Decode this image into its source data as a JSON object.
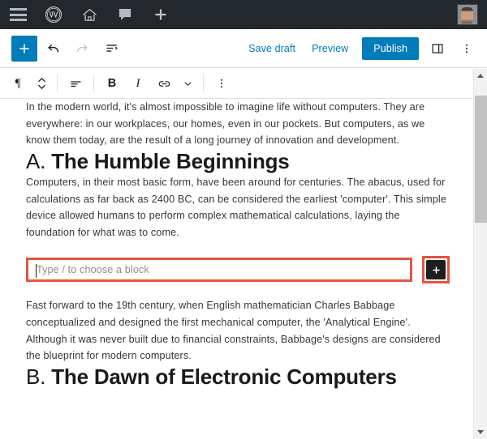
{
  "adminbar": {
    "menu_icon": "hamburger-menu-icon",
    "wordpress_icon": "wordpress-logo-icon",
    "home_icon": "home-icon",
    "comments_icon": "comment-bubble-icon",
    "new_icon": "plus-icon",
    "avatar": "user-avatar",
    "background_color": "#23282d"
  },
  "header": {
    "inserter_label": "+",
    "undo_icon": "undo-arrow-icon",
    "redo_icon": "redo-arrow-icon",
    "listview_icon": "list-view-icon",
    "save_draft_label": "Save draft",
    "preview_label": "Preview",
    "publish_label": "Publish",
    "settings_icon": "settings-sidebar-icon",
    "options_icon": "more-options-icon",
    "accent_color": "#007cba"
  },
  "block_toolbar": {
    "block_type_icon": "paragraph-icon",
    "block_type_glyph": "¶",
    "move_icon": "move-up-down-icon",
    "align_icon": "text-align-icon",
    "bold_label": "B",
    "italic_label": "I",
    "link_icon": "link-icon",
    "more_rich_text_icon": "chevron-down-icon",
    "options_icon": "more-options-icon"
  },
  "content": {
    "paragraph_1": "In the modern world, it's almost impossible to imagine life without computers. They are everywhere: in our workplaces, our homes, even in our pockets. But computers, as we know them today, are the result of a long journey of innovation and development.",
    "heading_a_prefix": "A. ",
    "heading_a_text": "The Humble Beginnings",
    "paragraph_2": "Computers, in their most basic form, have been around for centuries. The abacus, used for calculations as far back as 2400 BC, can be considered the earliest 'computer'. This simple device allowed humans to perform complex mathematical calculations, laying the foundation for what was to come.",
    "empty_block_placeholder": "Type / to choose a block",
    "add_block_label": "+",
    "paragraph_3": "Fast forward to the 19th century, when English mathematician Charles Babbage conceptualized and designed the first mechanical computer, the 'Analytical Engine'. Although it was never built due to financial constraints, Babbage's designs are considered the blueprint for modern computers.",
    "heading_b_prefix": "B. ",
    "heading_b_text": "The Dawn of Electronic Computers",
    "highlight_color": "#e2563f"
  },
  "scrollbar": {
    "up_icon": "scroll-up-arrow-icon",
    "down_icon": "scroll-down-arrow-icon",
    "thumb": "scrollbar-thumb"
  }
}
